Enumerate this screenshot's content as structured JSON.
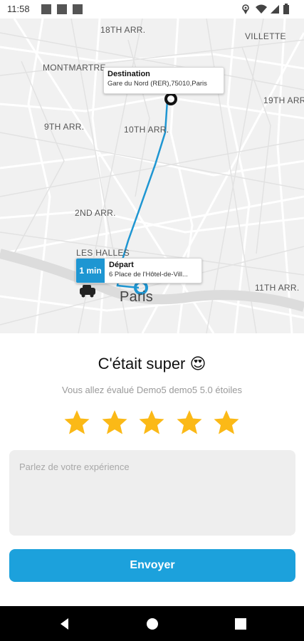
{
  "status_bar": {
    "time": "11:58",
    "notification_icons": [
      "notification-square-icon",
      "notification-square-icon",
      "notification-square-icon"
    ],
    "system_icons": [
      "location-icon",
      "wifi-icon",
      "signal-icon",
      "battery-icon"
    ]
  },
  "map": {
    "labels": {
      "arr18": "18TH ARR.",
      "villette": "VILLETTE",
      "montmartre": "MONTMARTRE",
      "arr19": "19TH ARR.",
      "arr9": "9TH ARR.",
      "arr10": "10TH ARR.",
      "arr2": "2ND ARR.",
      "halles": "LES HALLES",
      "paris": "Paris",
      "arr11": "11TH ARR."
    },
    "destination": {
      "title": "Destination",
      "address": "Gare du Nord (RER),75010,Paris"
    },
    "departure": {
      "eta": "1 min",
      "title": "Départ",
      "address": "6 Place de l'Hôtel-de-Vill..."
    },
    "route_color": "#1e96d2"
  },
  "rating": {
    "title": "C'était super 😍",
    "subtitle": "Vous allez évalué Demo5 demo5 5.0 étoiles",
    "stars": 5,
    "max_stars": 5,
    "star_color": "#fbb917"
  },
  "feedback": {
    "placeholder": "Parlez de votre expérience",
    "value": ""
  },
  "submit": {
    "label": "Envoyer",
    "color": "#1ca1dc"
  },
  "nav_bar": {
    "icons": [
      "back-icon",
      "home-icon",
      "recents-icon"
    ]
  }
}
